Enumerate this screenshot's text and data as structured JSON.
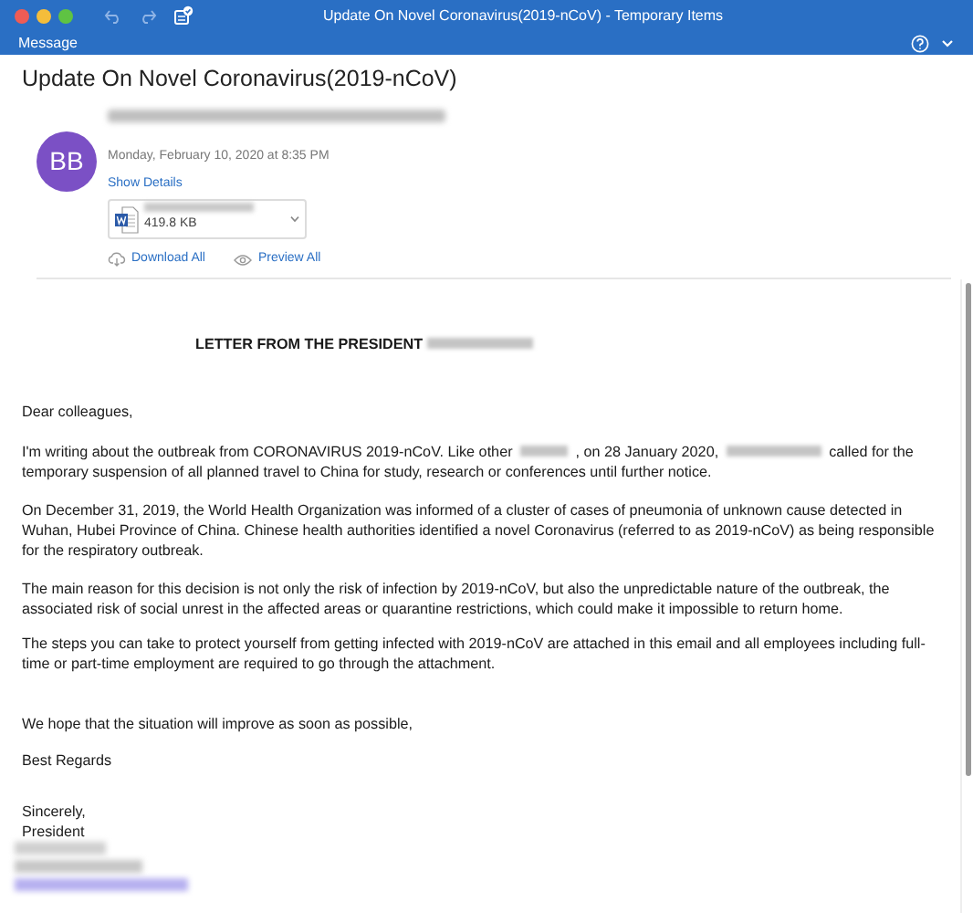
{
  "window": {
    "title": "Update On Novel Coronavirus(2019-nCoV) - Temporary Items"
  },
  "ribbon": {
    "tabs": [
      {
        "label": "Message",
        "selected": true
      }
    ]
  },
  "message": {
    "subject": "Update On Novel Coronavirus(2019-nCoV)",
    "sender_initials": "BB",
    "date": "Monday, February 10, 2020 at 8:35 PM",
    "show_details": "Show Details",
    "attachment": {
      "size": "419.8 KB"
    },
    "actions": [
      {
        "kind": "download",
        "label": "Download All"
      },
      {
        "kind": "preview",
        "label": "Preview All"
      }
    ]
  },
  "body": [
    {
      "kind": "heading",
      "parts": [
        {
          "kind": "text",
          "text": "LETTER FROM THE PRESIDENT"
        },
        {
          "kind": "redacted"
        }
      ]
    },
    {
      "kind": "paragraph",
      "parts": [
        {
          "kind": "text",
          "text": "Dear colleagues,"
        }
      ]
    },
    {
      "kind": "paragraph",
      "parts": [
        {
          "kind": "text",
          "text": "I'm writing about the outbreak from CORONAVIRUS 2019-nCoV. Like other"
        },
        {
          "kind": "redacted"
        },
        {
          "kind": "text",
          "text": ", on 28 January 2020,"
        },
        {
          "kind": "redacted"
        },
        {
          "kind": "text",
          "text": "called for the"
        },
        {
          "kind": "text",
          "text": "temporary suspension of all planned travel to China for study, research or conferences until further notice."
        }
      ]
    },
    {
      "kind": "paragraph",
      "parts": [
        {
          "kind": "text",
          "text": "On December 31, 2019, the World Health Organization was informed of a cluster of cases of pneumonia of unknown cause detected in Wuhan, Hubei Province of China. Chinese health authorities identified a novel Coronavirus (referred to as 2019-nCoV) as being responsible for the respiratory outbreak."
        }
      ]
    },
    {
      "kind": "paragraph",
      "parts": [
        {
          "kind": "text",
          "text": "The main reason for this decision is not only the risk of infection by 2019-nCoV, but also the unpredictable nature of the outbreak, the associated risk of social unrest in the affected areas or quarantine restrictions, which could make it impossible to return home."
        }
      ]
    },
    {
      "kind": "paragraph",
      "parts": [
        {
          "kind": "text",
          "text": "The steps you can take to protect yourself from getting infected with 2019-nCoV are attached in this email and all employees including full-time or part-time employment are required to go through the attachment."
        }
      ]
    },
    {
      "kind": "paragraph",
      "parts": [
        {
          "kind": "text",
          "text": "We hope that the situation will improve as soon as possible,"
        }
      ]
    },
    {
      "kind": "paragraph",
      "parts": [
        {
          "kind": "text",
          "text": "Best Regards"
        }
      ]
    },
    {
      "kind": "lines",
      "parts": [
        {
          "kind": "text",
          "text": "Sincerely,"
        },
        {
          "kind": "text",
          "text": "President"
        }
      ]
    },
    {
      "kind": "signature"
    }
  ]
}
